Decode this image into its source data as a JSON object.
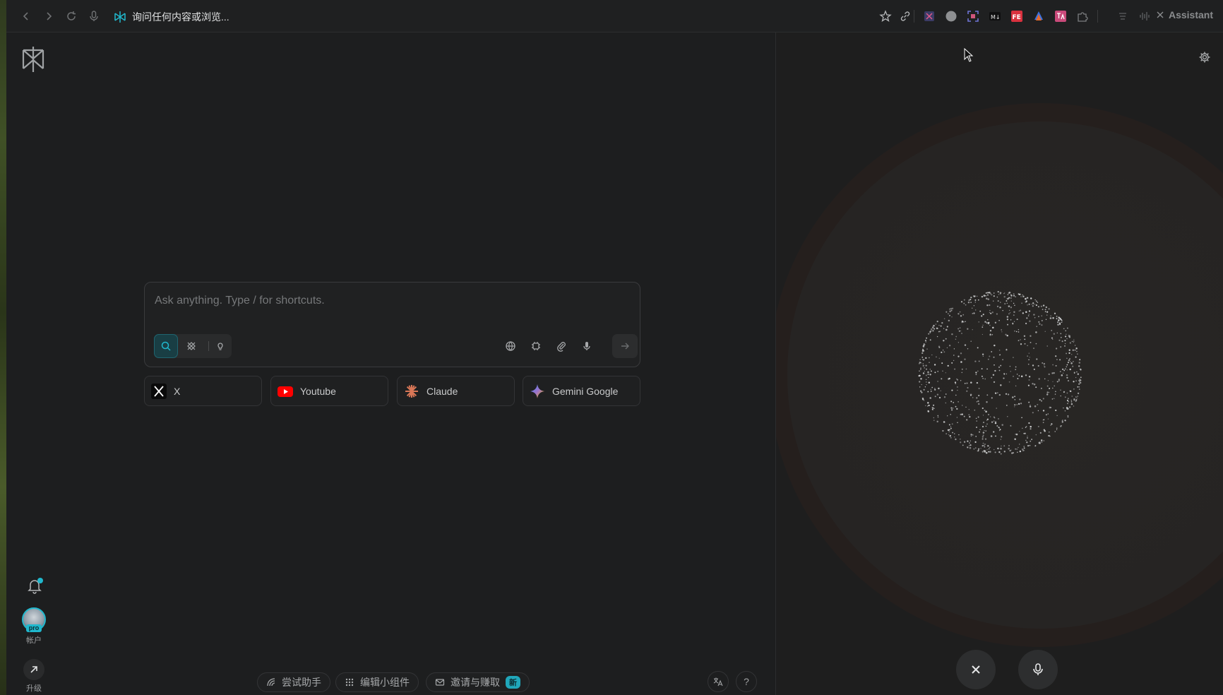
{
  "browser": {
    "url_text": "询问任何内容或浏览...",
    "assistant_tab_label": "Assistant"
  },
  "search": {
    "placeholder": "Ask anything. Type / for shortcuts."
  },
  "shortcuts": [
    {
      "label": "X"
    },
    {
      "label": "Youtube"
    },
    {
      "label": "Claude"
    },
    {
      "label": "Gemini Google"
    }
  ],
  "sidebar": {
    "account_label": "帐户",
    "pro_badge": "pro",
    "upgrade_label": "升级"
  },
  "bottom_bar": {
    "try_assistant": "尝试助手",
    "edit_widgets": "编辑小组件",
    "invite_earn": "邀请与赚取",
    "new_badge": "新",
    "help": "?"
  },
  "colors": {
    "accent": "#20b8cd",
    "background": "#1d1e1f"
  }
}
